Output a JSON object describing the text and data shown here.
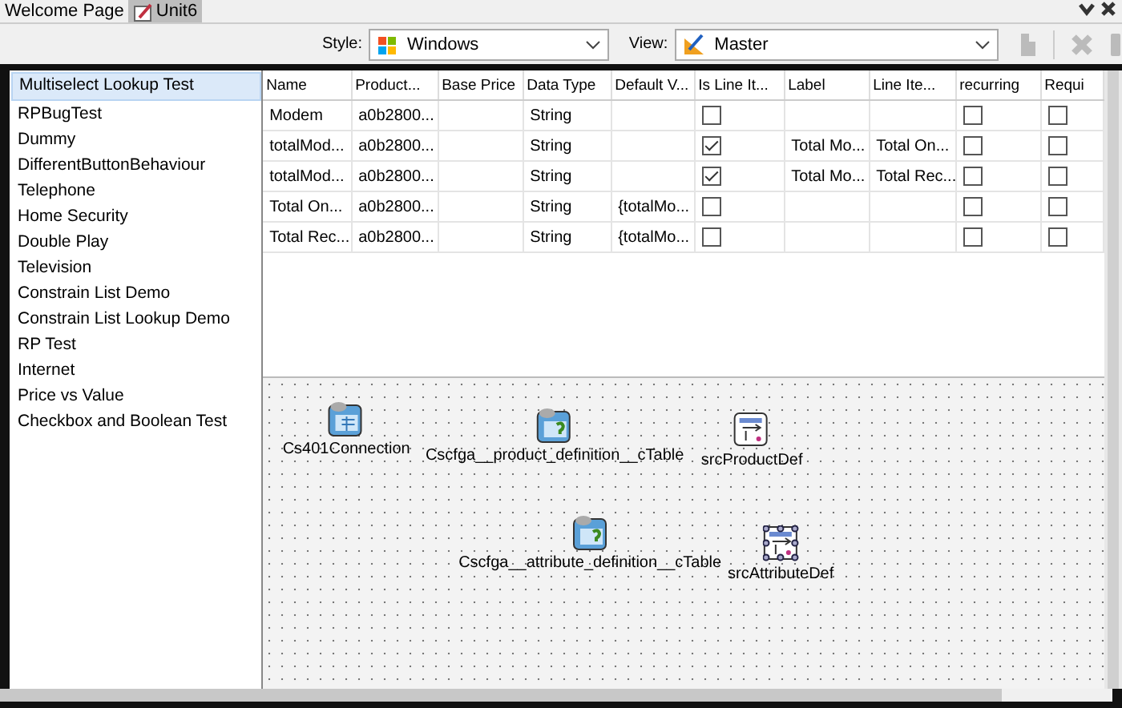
{
  "tabs": [
    {
      "label": "Welcome Page",
      "selected": false
    },
    {
      "label": "Unit6",
      "selected": true
    }
  ],
  "toolbar": {
    "style_label": "Style:",
    "style_value": "Windows",
    "view_label": "View:",
    "view_value": "Master"
  },
  "list": {
    "items": [
      {
        "label": "Multiselect Lookup Test",
        "selected": true
      },
      {
        "label": "RPBugTest",
        "selected": false
      },
      {
        "label": "Dummy",
        "selected": false
      },
      {
        "label": "DifferentButtonBehaviour",
        "selected": false
      },
      {
        "label": "Telephone",
        "selected": false
      },
      {
        "label": "Home Security",
        "selected": false
      },
      {
        "label": "Double Play",
        "selected": false
      },
      {
        "label": "Television",
        "selected": false
      },
      {
        "label": "Constrain List Demo",
        "selected": false
      },
      {
        "label": "Constrain List Lookup Demo",
        "selected": false
      },
      {
        "label": "RP Test",
        "selected": false
      },
      {
        "label": "Internet",
        "selected": false
      },
      {
        "label": "Price vs Value",
        "selected": false
      },
      {
        "label": "Checkbox and Boolean Test",
        "selected": false
      }
    ]
  },
  "table": {
    "columns": [
      {
        "label": "Name",
        "kind": "text"
      },
      {
        "label": "Product...",
        "kind": "text"
      },
      {
        "label": "Base Price",
        "kind": "text"
      },
      {
        "label": "Data Type",
        "kind": "text"
      },
      {
        "label": "Default V...",
        "kind": "text"
      },
      {
        "label": "Is Line It...",
        "kind": "check"
      },
      {
        "label": "Label",
        "kind": "text"
      },
      {
        "label": "Line Ite...",
        "kind": "text"
      },
      {
        "label": "recurring",
        "kind": "check"
      },
      {
        "label": "Requi",
        "kind": "check"
      }
    ],
    "rows": [
      {
        "cells": [
          {
            "text": "Modem"
          },
          {
            "text": "a0b2800..."
          },
          {},
          {
            "text": "String"
          },
          {},
          {
            "checked": false
          },
          {},
          {},
          {
            "checked": false
          },
          {
            "checked": false
          }
        ]
      },
      {
        "cells": [
          {
            "text": "totalMod..."
          },
          {
            "text": "a0b2800..."
          },
          {},
          {
            "text": "String"
          },
          {},
          {
            "checked": true
          },
          {
            "text": "Total Mo..."
          },
          {
            "text": "Total On..."
          },
          {
            "checked": false
          },
          {
            "checked": false
          }
        ]
      },
      {
        "cells": [
          {
            "text": "totalMod..."
          },
          {
            "text": "a0b2800..."
          },
          {},
          {
            "text": "String"
          },
          {},
          {
            "checked": true
          },
          {
            "text": "Total Mo..."
          },
          {
            "text": "Total Rec..."
          },
          {
            "checked": false
          },
          {
            "checked": false
          }
        ]
      },
      {
        "cells": [
          {
            "text": "Total On..."
          },
          {
            "text": "a0b2800..."
          },
          {},
          {
            "text": "String"
          },
          {
            "text": "{totalMo..."
          },
          {
            "checked": false
          },
          {},
          {},
          {
            "checked": false
          },
          {
            "checked": false
          }
        ]
      },
      {
        "cells": [
          {
            "text": "Total Rec..."
          },
          {
            "text": "a0b2800..."
          },
          {},
          {
            "text": "String"
          },
          {
            "text": "{totalMo..."
          },
          {
            "checked": false
          },
          {},
          {},
          {
            "checked": false
          },
          {
            "checked": false
          }
        ]
      }
    ]
  },
  "canvas": {
    "components": [
      {
        "label": "Cs401Connection",
        "kind": "connection",
        "selected": false
      },
      {
        "label": "Cscfga__product_definition__cTable",
        "kind": "table",
        "selected": false
      },
      {
        "label": "srcProductDef",
        "kind": "source",
        "selected": false
      },
      {
        "label": "Cscfga__attribute_definition__cTable",
        "kind": "table",
        "selected": false
      },
      {
        "label": "srcAttributeDef",
        "kind": "source",
        "selected": true
      }
    ]
  }
}
